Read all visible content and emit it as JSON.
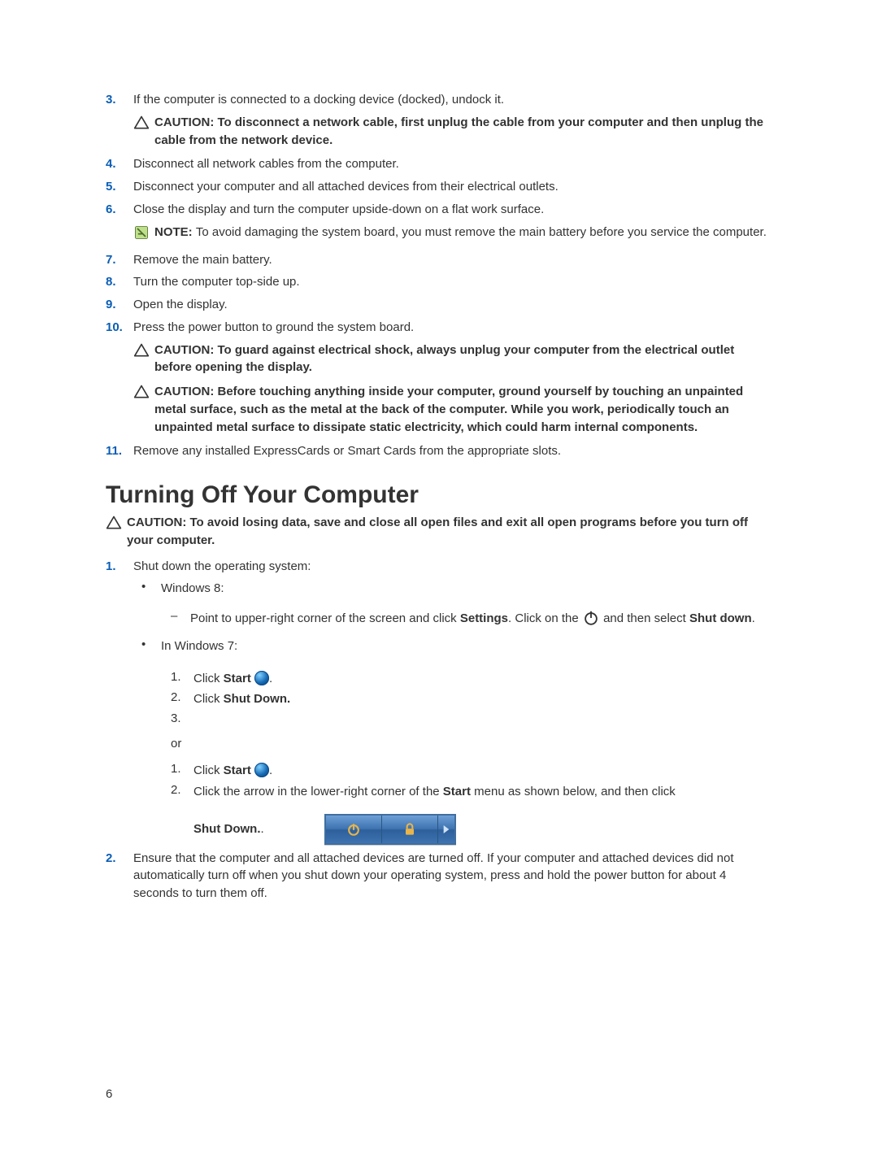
{
  "steps_a": [
    {
      "n": "3.",
      "t": "If the computer is connected to a docking device (docked), undock it."
    }
  ],
  "caution1_label": "CAUTION: ",
  "caution1_text": "To disconnect a network cable, first unplug the cable from your computer and then unplug the cable from the network device.",
  "steps_b": [
    {
      "n": "4.",
      "t": "Disconnect all network cables from the computer."
    },
    {
      "n": "5.",
      "t": "Disconnect your computer and all attached devices from their electrical outlets."
    },
    {
      "n": "6.",
      "t": "Close the display and turn the computer upside-down on a flat work surface."
    }
  ],
  "note1_label": "NOTE: ",
  "note1_text": "To avoid damaging the system board, you must remove the main battery before you service the computer.",
  "steps_c": [
    {
      "n": "7.",
      "t": "Remove the main battery."
    },
    {
      "n": "8.",
      "t": "Turn the computer top-side up."
    },
    {
      "n": "9.",
      "t": "Open the display."
    },
    {
      "n": "10.",
      "t": "Press the power button to ground the system board."
    }
  ],
  "caution2_label": "CAUTION: ",
  "caution2_text": "To guard against electrical shock, always unplug your computer from the electrical outlet before opening the display.",
  "caution3_label": "CAUTION: ",
  "caution3_text": "Before touching anything inside your computer, ground yourself by touching an unpainted metal surface, such as the metal at the back of the computer. While you work, periodically touch an unpainted metal surface to dissipate static electricity, which could harm internal components.",
  "steps_d": [
    {
      "n": "11.",
      "t": "Remove any installed ExpressCards or Smart Cards from the appropriate slots."
    }
  ],
  "section_heading": "Turning Off Your Computer",
  "caution4_label": "CAUTION: ",
  "caution4_text": "To avoid losing data, save and close all open files and exit all open programs before you turn off your computer.",
  "shut_step1": {
    "n": "1.",
    "t": "Shut down the operating system:"
  },
  "bul_win8": "Windows 8:",
  "dash_pre": "Point to upper-right corner of the screen and click ",
  "dash_settings": "Settings",
  "dash_mid": ". Click on the ",
  "dash_post": " and then select ",
  "dash_shutdown": "Shut down",
  "bul_win7": "In Windows 7:",
  "w7a_1_pre": "Click ",
  "w7a_1_bold": "Start ",
  "w7a_2_pre": "Click ",
  "w7a_2_bold": "Shut Down.",
  "w7a_3": "",
  "or_label": "or",
  "w7b_1_pre": "Click ",
  "w7b_1_bold": "Start ",
  "w7b_2_pre": "Click the arrow in the lower-right corner of the ",
  "w7b_2_bold": "Start",
  "w7b_2_post": " menu as shown below, and then click",
  "shutdown_line_bold": "Shut Down.",
  "shutdown_line_post": ".",
  "shut_step2": {
    "n": "2.",
    "t": "Ensure that the computer and all attached devices are turned off. If your computer and attached devices did not automatically turn off when you shut down your operating system, press and hold the power button for about 4 seconds to turn them off."
  },
  "page_number": "6"
}
